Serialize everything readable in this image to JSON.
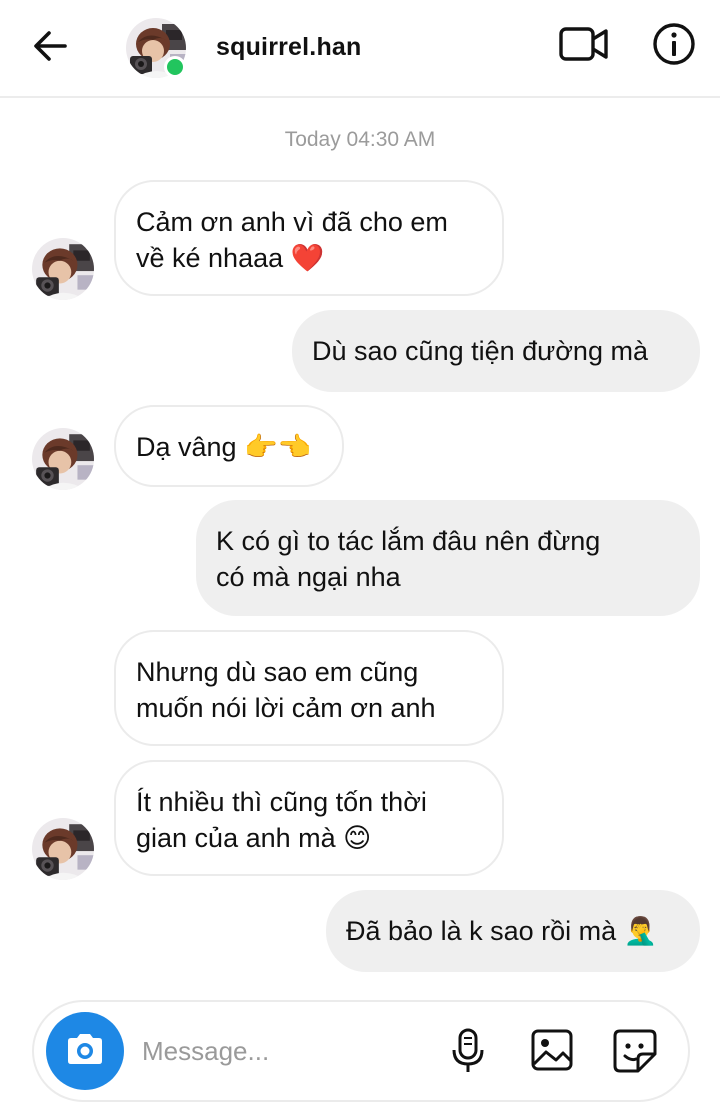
{
  "header": {
    "username": "squirrel.han",
    "online": true,
    "icons": {
      "back": "arrow-left-icon",
      "video": "video-camera-icon",
      "info": "info-icon"
    }
  },
  "timestamp": "Today 04:30 AM",
  "messages": [
    {
      "side": "in",
      "lines": [
        "Cảm ơn anh vì đã cho em",
        "về ké nhaaa ❤️"
      ]
    },
    {
      "side": "out",
      "lines": [
        "Dù sao cũng tiện đường mà"
      ]
    },
    {
      "side": "in",
      "lines": [
        "Dạ vâng 👉👈"
      ]
    },
    {
      "side": "out",
      "lines": [
        "K có gì to tác lắm đâu nên đừng",
        "có mà ngại nha"
      ]
    },
    {
      "side": "in",
      "lines": [
        "Nhưng dù sao em cũng",
        "muốn nói lời cảm ơn anh"
      ]
    },
    {
      "side": "in",
      "lines": [
        "Ít nhiều thì cũng tốn thời",
        "gian của anh mà 😊"
      ]
    },
    {
      "side": "out",
      "lines": [
        "Đã bảo là k sao rồi mà 🤦‍♂️"
      ]
    }
  ],
  "composer": {
    "placeholder": "Message...",
    "icons": {
      "camera": "camera-icon",
      "mic": "microphone-icon",
      "gallery": "image-icon",
      "sticker": "sticker-icon"
    },
    "accent": "#1e88e5"
  },
  "colors": {
    "online": "#22c55e",
    "outgoing_bubble": "#efefef",
    "incoming_border": "#ebebeb",
    "timestamp": "#9b9b9b"
  }
}
